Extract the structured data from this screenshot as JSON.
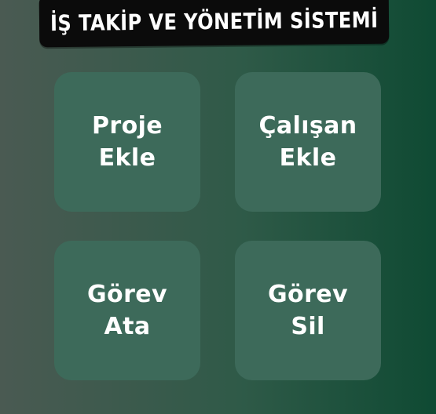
{
  "header": {
    "title": "İŞ TAKİP VE YÖNETİM SİSTEMİ"
  },
  "menu": {
    "buttons": [
      {
        "line1": "Proje",
        "line2": "Ekle"
      },
      {
        "line1": "Çalışan",
        "line2": "Ekle"
      },
      {
        "line1": "Görev",
        "line2": "Ata"
      },
      {
        "line1": "Görev",
        "line2": "Sil"
      }
    ]
  },
  "colors": {
    "banner": "#0b0b0b",
    "tile": "#3d6a5a",
    "text": "#ffffff"
  }
}
